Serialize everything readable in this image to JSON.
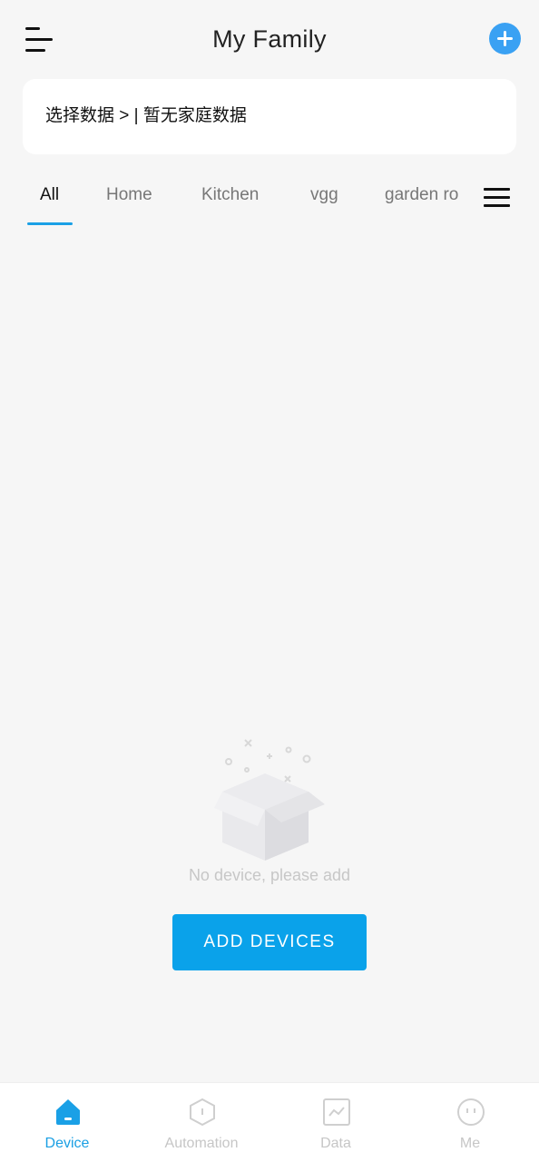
{
  "header": {
    "title": "My Family"
  },
  "selector": {
    "text": "选择数据 > | 暂无家庭数据"
  },
  "tabs": [
    {
      "label": "All",
      "active": true
    },
    {
      "label": "Home"
    },
    {
      "label": "Kitchen"
    },
    {
      "label": "vgg"
    },
    {
      "label": "garden ro"
    }
  ],
  "empty": {
    "message": "No device, please add",
    "button": "ADD DEVICES"
  },
  "bottom_nav": [
    {
      "label": "Device",
      "icon": "home-icon",
      "active": true
    },
    {
      "label": "Automation",
      "icon": "hexagon-icon"
    },
    {
      "label": "Data",
      "icon": "chart-icon"
    },
    {
      "label": "Me",
      "icon": "face-icon"
    }
  ],
  "colors": {
    "accent": "#0aa2ea",
    "add_button": "#3aa1f3",
    "background": "#f6f6f6"
  }
}
